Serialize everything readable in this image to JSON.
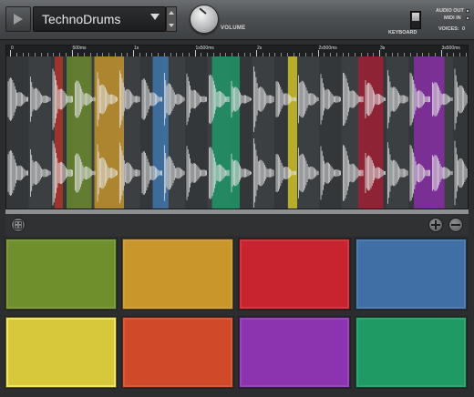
{
  "toolbar": {
    "preset_name": "TechnoDrums",
    "volume_label": "VOLUME",
    "keyboard_label": "KEYBOARD",
    "audio_out_label": "AUDIO OUT",
    "midi_in_label": "MIDI IN",
    "voices_label": "VOICES:",
    "voices_value": "0"
  },
  "ruler": {
    "labels": [
      "0",
      "500ms",
      "1s",
      "1s500ms",
      "2s",
      "2s500ms",
      "3s",
      "3s500ms"
    ]
  },
  "slices": [
    {
      "color": "#b3362a",
      "start": 0.104,
      "end": 0.122
    },
    {
      "color": "#6a8a2d",
      "start": 0.13,
      "end": 0.184
    },
    {
      "color": "#c8962c",
      "start": 0.19,
      "end": 0.254
    },
    {
      "color": "#3f78b0",
      "start": 0.316,
      "end": 0.35
    },
    {
      "color": "#1f9a6a",
      "start": 0.444,
      "end": 0.504
    },
    {
      "color": "#d6c62a",
      "start": 0.608,
      "end": 0.628
    },
    {
      "color": "#a21f35",
      "start": 0.76,
      "end": 0.814
    },
    {
      "color": "#8a2da8",
      "start": 0.88,
      "end": 0.946
    }
  ],
  "pads": [
    {
      "name": "pad-1",
      "color": "#6f8f2c"
    },
    {
      "name": "pad-2",
      "color": "#c9962b"
    },
    {
      "name": "pad-3",
      "color": "#c8242f"
    },
    {
      "name": "pad-4",
      "color": "#3f6fa4"
    },
    {
      "name": "pad-5",
      "color": "#d7c73a"
    },
    {
      "name": "pad-6",
      "color": "#d04a2a"
    },
    {
      "name": "pad-7",
      "color": "#8c34b0"
    },
    {
      "name": "pad-8",
      "color": "#1f9a64"
    }
  ],
  "icons": {
    "play": "play-icon",
    "dropdown": "chevron-down-icon",
    "randomize": "dice-icon",
    "zoom_in": "plus-icon",
    "zoom_out": "minus-icon"
  }
}
